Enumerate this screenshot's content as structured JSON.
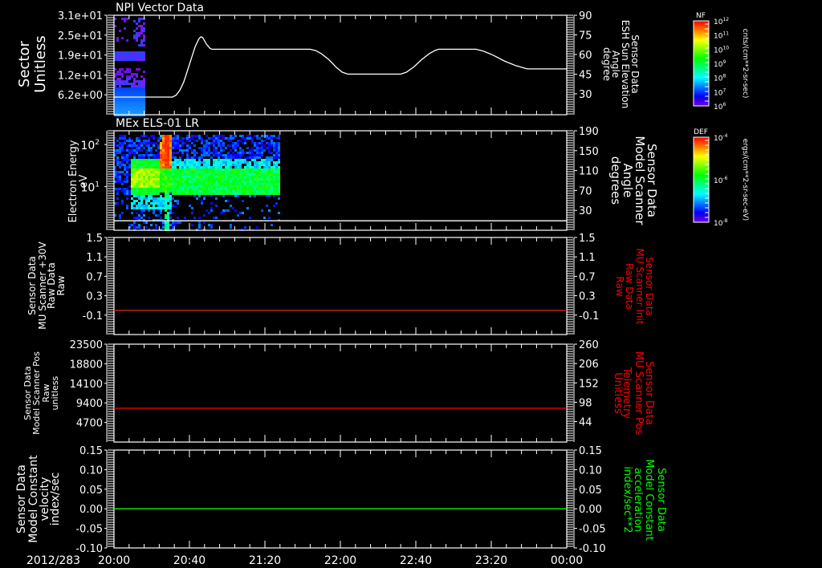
{
  "date_label": "2012/283",
  "time_axis": {
    "range": [
      "20:00",
      "00:00"
    ],
    "ticks": [
      "20:00",
      "20:40",
      "21:20",
      "22:00",
      "22:40",
      "23:20",
      "00:00"
    ]
  },
  "chart_data": [
    {
      "type": "heatmap+line",
      "title": "NPI Vector Data",
      "ylabel_left": [
        "Sector",
        "Unitless"
      ],
      "ylim_left": [
        0,
        31
      ],
      "yticks_left": [
        {
          "value": 31,
          "label": "3.1e+01"
        },
        {
          "value": 24.8,
          "label": "2.5e+01"
        },
        {
          "value": 18.6,
          "label": "1.9e+01"
        },
        {
          "value": 12.4,
          "label": "1.2e+01"
        },
        {
          "value": 6.2,
          "label": "6.2e+00"
        }
      ],
      "ylabel_right": [
        "Sensor Data",
        "ESH Sun Elevation",
        "Angle",
        "degree"
      ],
      "ylabel_right_color": "#ffffff",
      "ylim_right": [
        14,
        90
      ],
      "yticks_right": [
        {
          "value": 90,
          "label": "90"
        },
        {
          "value": 75,
          "label": "75"
        },
        {
          "value": 60,
          "label": "60"
        },
        {
          "value": 45,
          "label": "45"
        },
        {
          "value": 30,
          "label": "30"
        }
      ],
      "heatmap_time_range": [
        "20:00",
        "20:16"
      ],
      "series": [
        {
          "axis": "right",
          "color": "#ffffff",
          "points": [
            [
              "20:00",
              27.5
            ],
            [
              "20:31",
              27.5
            ],
            [
              "20:33",
              29
            ],
            [
              "20:35",
              33
            ],
            [
              "20:37",
              39
            ],
            [
              "20:39",
              48
            ],
            [
              "20:41",
              57
            ],
            [
              "20:43",
              66
            ],
            [
              "20:45",
              72
            ],
            [
              "20:46",
              73.5
            ],
            [
              "20:47",
              73
            ],
            [
              "20:49",
              68
            ],
            [
              "20:51",
              64.5
            ],
            [
              "20:52",
              64
            ],
            [
              "21:44",
              64
            ],
            [
              "21:47",
              63
            ],
            [
              "21:50",
              60.5
            ],
            [
              "21:54",
              56
            ],
            [
              "21:58",
              50
            ],
            [
              "22:01",
              46.5
            ],
            [
              "22:04",
              45
            ],
            [
              "22:32",
              45
            ],
            [
              "22:35",
              46.5
            ],
            [
              "22:39",
              50.5
            ],
            [
              "22:43",
              56
            ],
            [
              "22:47",
              60.5
            ],
            [
              "22:50",
              63
            ],
            [
              "22:52",
              64
            ],
            [
              "23:12",
              64
            ],
            [
              "23:16",
              62.5
            ],
            [
              "23:21",
              59.5
            ],
            [
              "23:27",
              55
            ],
            [
              "23:33",
              51.5
            ],
            [
              "23:39",
              49
            ],
            [
              "00:00",
              49
            ]
          ]
        }
      ],
      "colorbar": {
        "label": "NF",
        "units": "cnts/(cm**2-sr-sec)",
        "scale": "log",
        "ticks": [
          {
            "base": "10",
            "exp": "12"
          },
          {
            "base": "10",
            "exp": "11"
          },
          {
            "base": "10",
            "exp": "10"
          },
          {
            "base": "10",
            "exp": "9"
          },
          {
            "base": "10",
            "exp": "8"
          },
          {
            "base": "10",
            "exp": "7"
          },
          {
            "base": "10",
            "exp": "6"
          }
        ]
      }
    },
    {
      "type": "heatmap+line",
      "title": "MEx ELS-01 LR",
      "ylabel_left": [
        "Electron Energy",
        "eV"
      ],
      "yscale_left": "log",
      "ylim_left": [
        0.92,
        212
      ],
      "yticks_left": [
        {
          "value": 100,
          "base": "10",
          "exp": "2"
        },
        {
          "value": 10,
          "base": "10",
          "exp": "1"
        }
      ],
      "ylabel_right": [
        "Sensor Data",
        "Model Scanner",
        "Angle",
        "degrees"
      ],
      "ylabel_right_color": "#ffffff",
      "ylim_right": [
        -10,
        190
      ],
      "yticks_right": [
        {
          "value": 190,
          "label": "190"
        },
        {
          "value": 150,
          "label": "150"
        },
        {
          "value": 110,
          "label": "110"
        },
        {
          "value": 70,
          "label": "70"
        },
        {
          "value": 30,
          "label": "30"
        }
      ],
      "heatmap_time_range": [
        "20:00",
        "21:28"
      ],
      "series": [
        {
          "axis": "right",
          "color": "#ffffff",
          "points": [
            [
              "20:00",
              9
            ],
            [
              "00:00",
              9
            ]
          ]
        }
      ],
      "colorbar": {
        "label": "DEF",
        "units": "ergs/(cm**2-sr-sec-eV)",
        "scale": "log",
        "ticks": [
          {
            "base": "10",
            "exp": "-4"
          },
          {
            "base": "10",
            "exp": "-6"
          },
          {
            "base": "10",
            "exp": "-8"
          }
        ]
      }
    },
    {
      "type": "line",
      "ylabel_left": [
        "Sensor Data",
        "MU Scanner +30V",
        "Raw Data",
        "Raw"
      ],
      "ylim_left": [
        -0.5,
        1.5
      ],
      "yticks_left": [
        {
          "value": 1.5,
          "label": "1.5"
        },
        {
          "value": 1.1,
          "label": "1.1"
        },
        {
          "value": 0.7,
          "label": "0.7"
        },
        {
          "value": 0.3,
          "label": "0.3"
        },
        {
          "value": -0.1,
          "label": "-0.1"
        }
      ],
      "ylabel_right": [
        "Sensor Data",
        "MU Scanner Init",
        "Raw Data",
        "Raw"
      ],
      "ylabel_right_color": "#ff0000",
      "ylim_right": [
        -0.5,
        1.5
      ],
      "yticks_right": [
        {
          "value": 1.5,
          "label": "1.5"
        },
        {
          "value": 1.1,
          "label": "1.1"
        },
        {
          "value": 0.7,
          "label": "0.7"
        },
        {
          "value": 0.3,
          "label": "0.3"
        },
        {
          "value": -0.1,
          "label": "-0.1"
        }
      ],
      "series": [
        {
          "axis": "right",
          "color": "#cc2020",
          "points": [
            [
              "20:00",
              0.0
            ],
            [
              "00:00",
              0.0
            ]
          ]
        }
      ]
    },
    {
      "type": "line",
      "ylabel_left": [
        "Sensor Data",
        "Model Scanner Pos",
        "Raw",
        "unitless"
      ],
      "ylim_left": [
        0,
        23500
      ],
      "yticks_left": [
        {
          "value": 23500,
          "label": "23500"
        },
        {
          "value": 18800,
          "label": "18800"
        },
        {
          "value": 14100,
          "label": "14100"
        },
        {
          "value": 9400,
          "label": "9400"
        },
        {
          "value": 4700,
          "label": "4700"
        }
      ],
      "ylabel_right": [
        "Sensor Data",
        "MU Scanner Pos",
        "Telemetry",
        "Unitless"
      ],
      "ylabel_right_color": "#ff0000",
      "ylim_right": [
        -13,
        260
      ],
      "yticks_right": [
        {
          "value": 260,
          "label": "260"
        },
        {
          "value": 206,
          "label": "206"
        },
        {
          "value": 152,
          "label": "152"
        },
        {
          "value": 98,
          "label": "98"
        },
        {
          "value": 44,
          "label": "44"
        }
      ],
      "series": [
        {
          "axis": "left",
          "color": "#ff0000",
          "points": [
            [
              "20:00",
              8100
            ],
            [
              "00:00",
              8100
            ]
          ]
        }
      ]
    },
    {
      "type": "line",
      "ylabel_left": [
        "Sensor Data",
        "Model Constant",
        "velocity",
        "index/sec"
      ],
      "ylim_left": [
        -0.1,
        0.15
      ],
      "yticks_left": [
        {
          "value": 0.15,
          "label": "0.15"
        },
        {
          "value": 0.1,
          "label": "0.10"
        },
        {
          "value": 0.05,
          "label": "0.05"
        },
        {
          "value": 0.0,
          "label": "0.00"
        },
        {
          "value": -0.05,
          "label": "-0.05"
        },
        {
          "value": -0.1,
          "label": "-0.10"
        }
      ],
      "ylabel_right": [
        "Sensor Data",
        "Model Constant",
        "acceleration",
        "index/sec**2"
      ],
      "ylabel_right_color": "#00ff00",
      "ylim_right": [
        -0.1,
        0.15
      ],
      "yticks_right": [
        {
          "value": 0.15,
          "label": "0.15"
        },
        {
          "value": 0.1,
          "label": "0.10"
        },
        {
          "value": 0.05,
          "label": "0.05"
        },
        {
          "value": 0.0,
          "label": "0.00"
        },
        {
          "value": -0.05,
          "label": "-0.05"
        },
        {
          "value": -0.1,
          "label": "-0.10"
        }
      ],
      "series": [
        {
          "axis": "right",
          "color": "#00ff00",
          "points": [
            [
              "20:00",
              0.0
            ],
            [
              "00:00",
              0.0
            ]
          ]
        }
      ]
    }
  ]
}
